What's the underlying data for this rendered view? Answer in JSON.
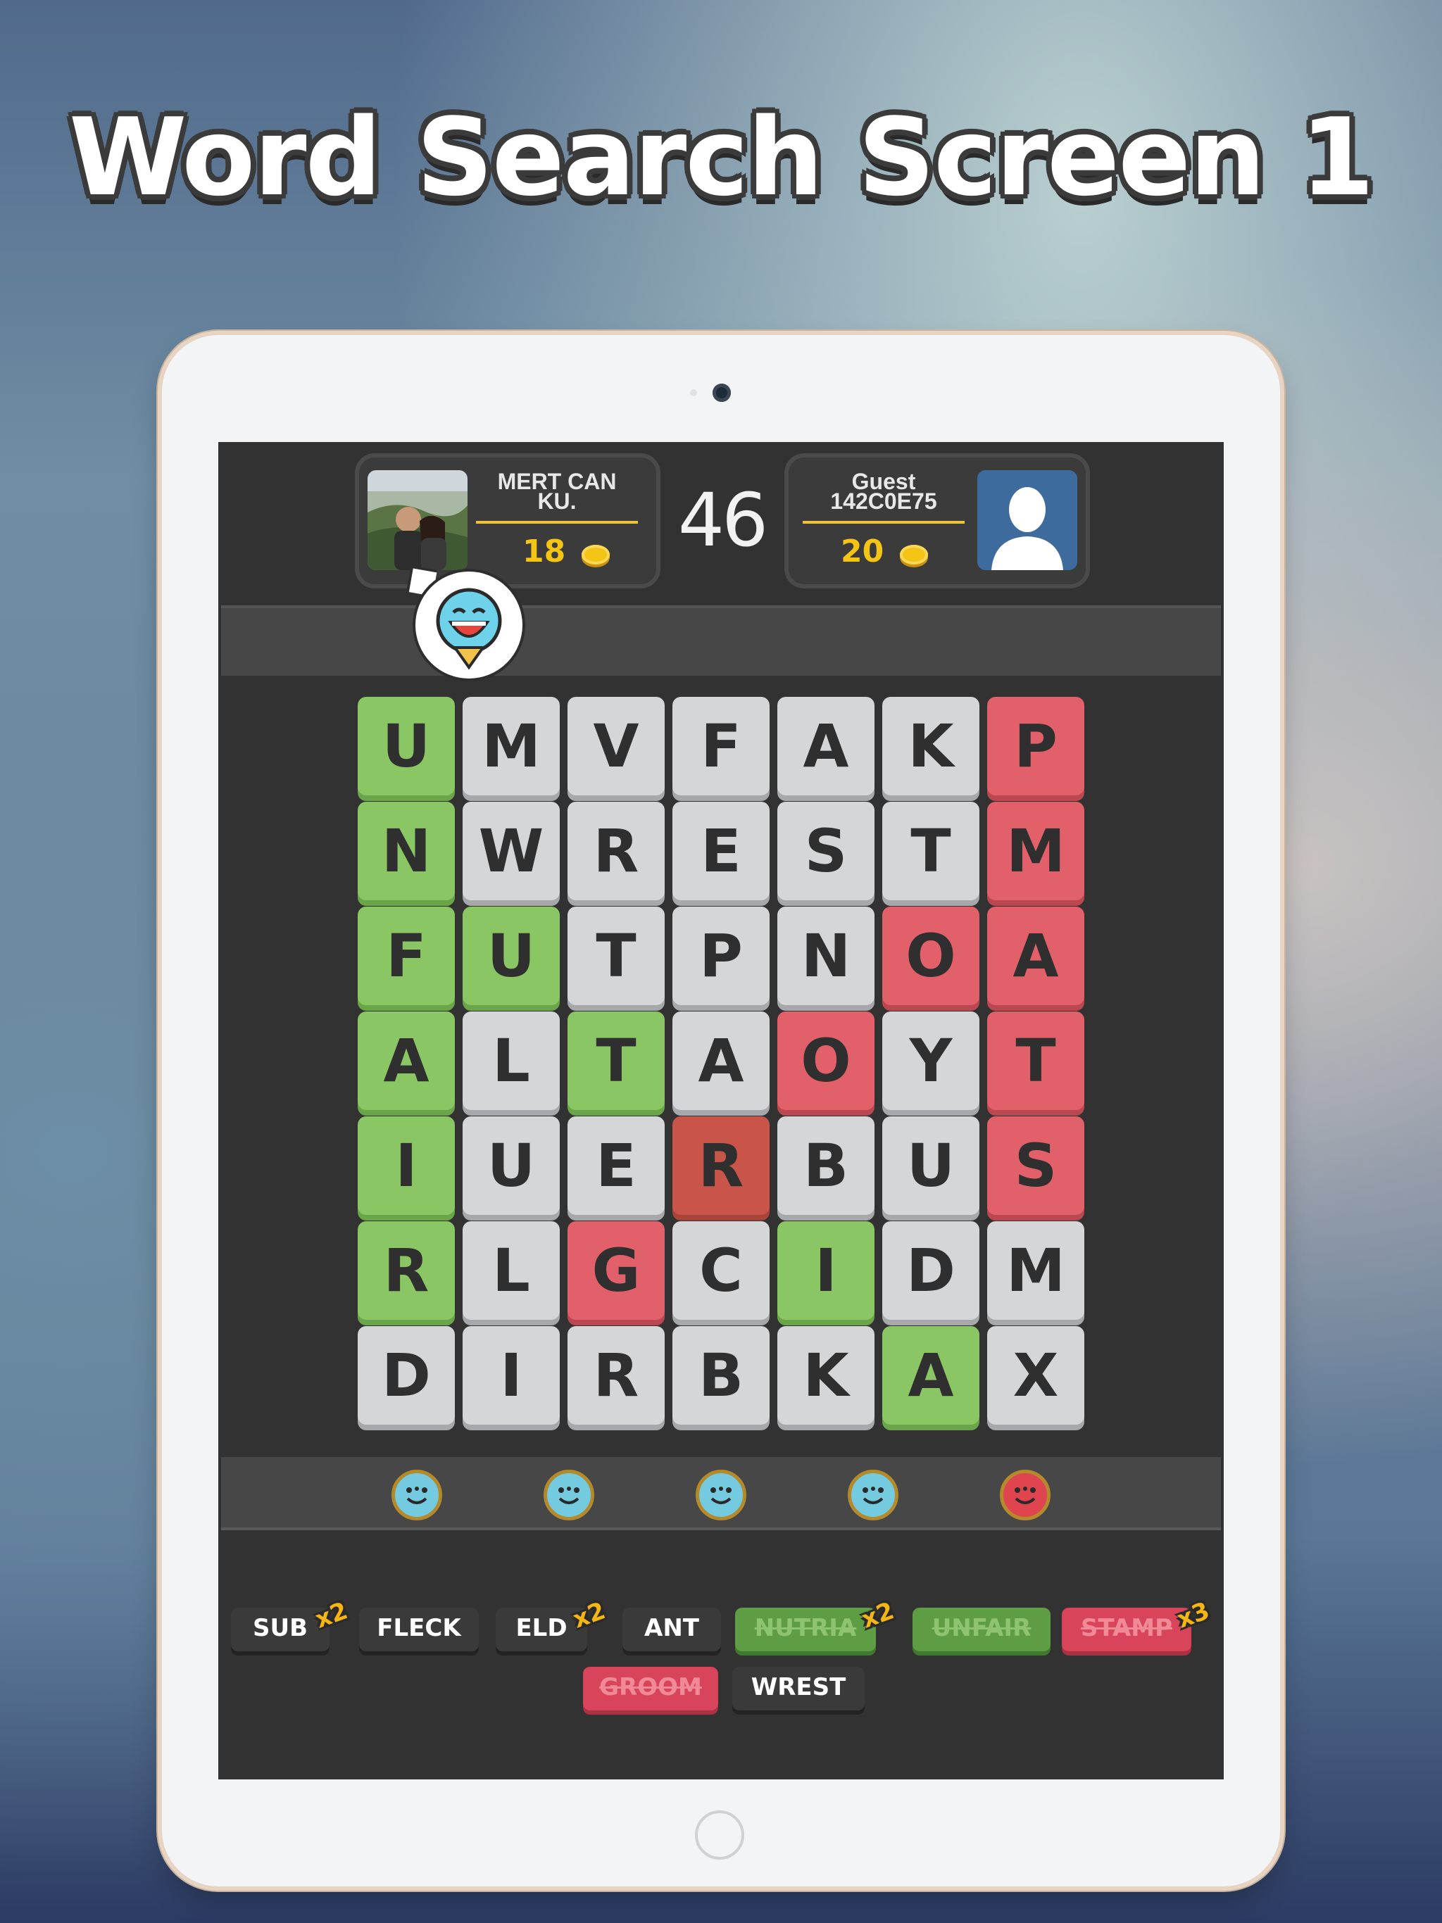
{
  "headline": "Word Search Screen 1",
  "players": [
    {
      "name": "MERT CAN KU.",
      "score": "18"
    },
    {
      "name": "Guest 142C0E75",
      "score": "20"
    }
  ],
  "timer": "46",
  "grid": [
    [
      "U",
      "M",
      "V",
      "F",
      "A",
      "K",
      "P"
    ],
    [
      "N",
      "W",
      "R",
      "E",
      "S",
      "T",
      "M"
    ],
    [
      "F",
      "U",
      "T",
      "P",
      "N",
      "O",
      "A"
    ],
    [
      "A",
      "L",
      "T",
      "A",
      "O",
      "Y",
      "T"
    ],
    [
      "I",
      "U",
      "E",
      "R",
      "B",
      "U",
      "S"
    ],
    [
      "R",
      "L",
      "G",
      "C",
      "I",
      "D",
      "M"
    ],
    [
      "D",
      "I",
      "R",
      "B",
      "K",
      "A",
      "X"
    ]
  ],
  "grid_states": [
    [
      "green",
      "",
      "",
      "",
      "",
      "",
      "red"
    ],
    [
      "green",
      "",
      "",
      "",
      "",
      "",
      "red"
    ],
    [
      "green",
      "green",
      "",
      "",
      "",
      "red",
      "red"
    ],
    [
      "green",
      "",
      "green",
      "",
      "red",
      "",
      "red"
    ],
    [
      "green",
      "",
      "",
      "darkred",
      "",
      "",
      "red"
    ],
    [
      "green",
      "",
      "red",
      "",
      "green",
      "",
      ""
    ],
    [
      "",
      "",
      "",
      "",
      "",
      "green",
      ""
    ]
  ],
  "reactions": [
    "laughing-emoji-icon",
    "cool-sunglasses-emoji-icon",
    "surprised-emoji-icon",
    "crying-emoji-icon",
    "angry-emoji-icon"
  ],
  "words": [
    {
      "label": "SUB",
      "multiplier": "x2",
      "state": "open"
    },
    {
      "label": "FLECK",
      "multiplier": "",
      "state": "open"
    },
    {
      "label": "ELD",
      "multiplier": "x2",
      "state": "open"
    },
    {
      "label": "ANT",
      "multiplier": "",
      "state": "open"
    },
    {
      "label": "NUTRIA",
      "multiplier": "x2",
      "state": "found-green"
    },
    {
      "label": "UNFAIR",
      "multiplier": "",
      "state": "found-green"
    },
    {
      "label": "STAMP",
      "multiplier": "x3",
      "state": "found-red"
    },
    {
      "label": "GROOM",
      "multiplier": "",
      "state": "found-red"
    },
    {
      "label": "WREST",
      "multiplier": "",
      "state": "open"
    }
  ],
  "colors": {
    "green": "#8ac664",
    "red": "#e2606a",
    "coin": "#f5c515",
    "screen_bg": "#323232"
  }
}
